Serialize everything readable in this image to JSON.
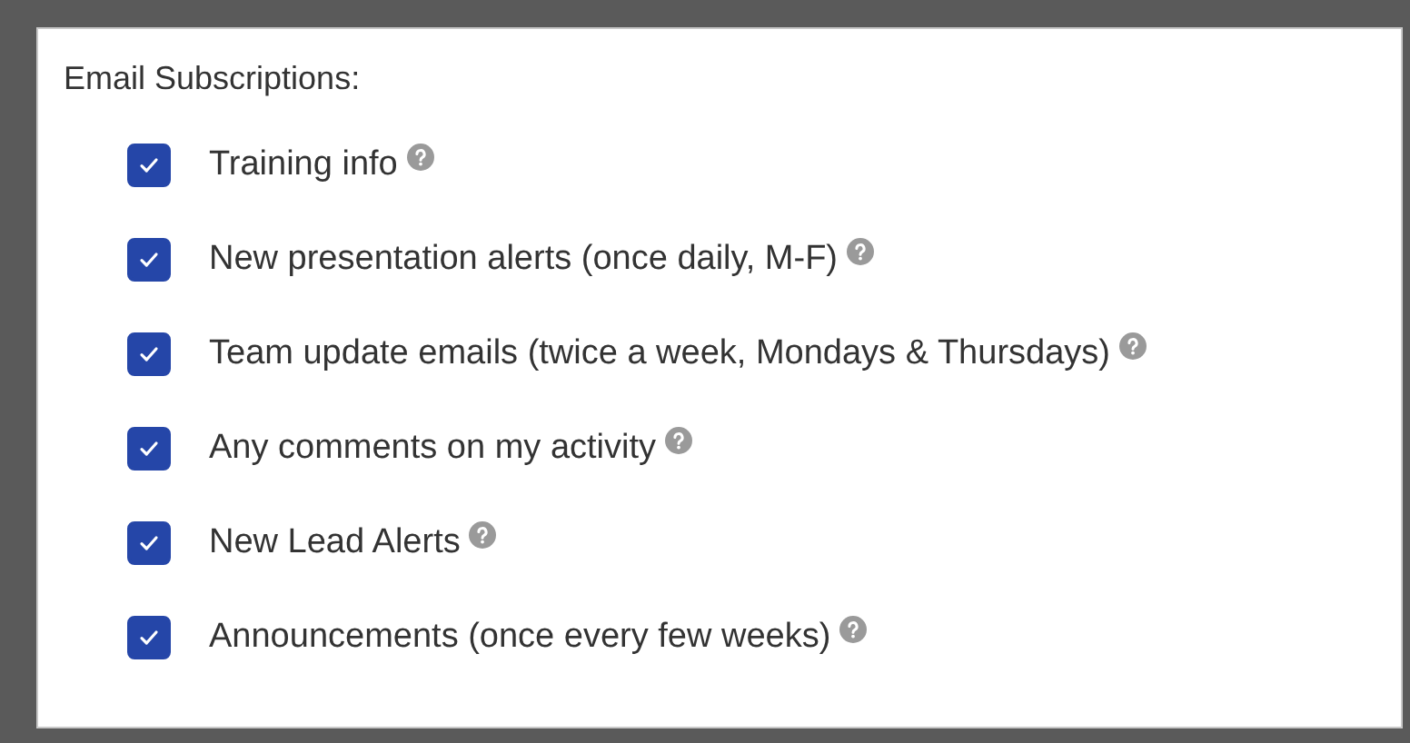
{
  "heading": "Email Subscriptions:",
  "subscriptions": [
    {
      "label": "Training info",
      "checked": true
    },
    {
      "label": "New presentation alerts (once daily, M-F)",
      "checked": true
    },
    {
      "label": "Team update emails (twice a week, Mondays & Thursdays)",
      "checked": true
    },
    {
      "label": "Any comments on my activity",
      "checked": true
    },
    {
      "label": "New Lead Alerts",
      "checked": true
    },
    {
      "label": "Announcements (once every few weeks)",
      "checked": true
    }
  ]
}
